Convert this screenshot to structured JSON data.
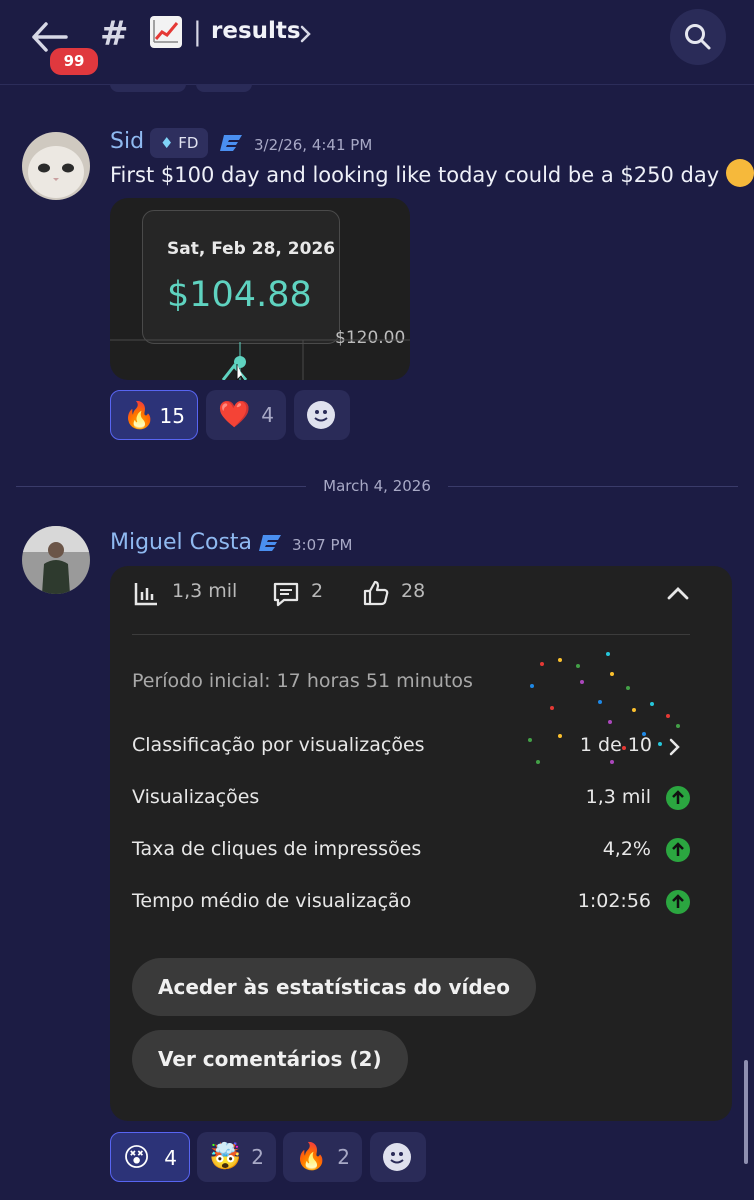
{
  "header": {
    "unread_count": "99",
    "channel_prefix": "#",
    "channel_separator": "|",
    "channel_name": "results",
    "icons": [
      "back-arrow-icon",
      "lock-hash-icon",
      "chart-increasing-emoji",
      "chevron-right-icon",
      "search-icon"
    ]
  },
  "messages": [
    {
      "username": "Sid",
      "tag": "FD",
      "timestamp": "3/2/26, 4:41 PM",
      "text": "First $100 day and looking like today could be a $250 day",
      "attachment": {
        "tooltip_date": "Sat, Feb 28, 2026",
        "tooltip_value": "$104.88",
        "axis_label": "$120.00"
      },
      "reactions": [
        {
          "emoji": "🔥",
          "count": "15",
          "active": true
        },
        {
          "emoji": "❤️",
          "count": "4",
          "active": false
        }
      ]
    },
    {
      "username": "Miguel Costa",
      "timestamp": "3:07 PM",
      "card": {
        "stats": {
          "views": "1,3 mil",
          "comments": "2",
          "likes": "28"
        },
        "period": "Período inicial: 17 horas 51 minutos",
        "rows": [
          {
            "label": "Classificação por visualizações",
            "value": "1 de 10"
          },
          {
            "label": "Visualizações",
            "value": "1,3 mil"
          },
          {
            "label": "Taxa de cliques de impressões",
            "value": "4,2%"
          },
          {
            "label": "Tempo médio de visualização",
            "value": "1:02:56"
          }
        ],
        "buttons": [
          "Aceder às estatísticas do vídeo",
          "Ver comentários (2)"
        ]
      },
      "reactions": [
        {
          "emoji": "😵",
          "count": "4",
          "active": true
        },
        {
          "emoji": "🤯",
          "count": "2",
          "active": false
        },
        {
          "emoji": "🔥",
          "count": "2",
          "active": false
        }
      ]
    }
  ],
  "date_divider": "March 4, 2026",
  "colors": {
    "background": "#1c1c44",
    "username": "#8fb9f0",
    "accent": "#5865f2",
    "badge": "#e0383e",
    "chart_value": "#5fd3c0",
    "up_indicator": "#2ba640"
  }
}
